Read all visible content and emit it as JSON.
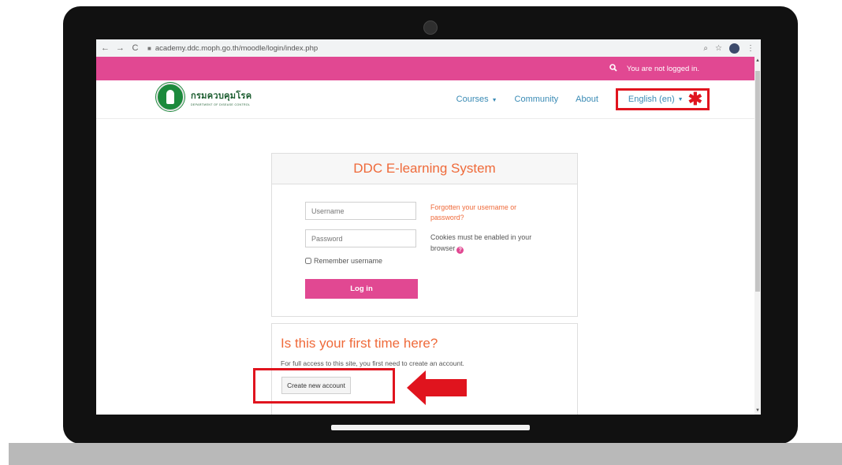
{
  "browser": {
    "url": "academy.ddc.moph.go.th/moodle/login/index.php",
    "back_icon": "←",
    "forward_icon": "→",
    "reload_icon": "C",
    "zoom_icon": "⌕",
    "star_icon": "☆",
    "menu_icon": "⋮"
  },
  "topbar": {
    "login_status": "You are not logged in.",
    "color": "#e14892"
  },
  "site": {
    "logo_thai": "กรมควบคุมโรค",
    "logo_english": "DEPARTMENT OF DISEASE CONTROL",
    "menu": {
      "courses": "Courses",
      "community": "Community",
      "about": "About",
      "language": "English (en)"
    },
    "annotation_asterisk": "✱"
  },
  "login": {
    "title": "DDC E-learning System",
    "username_placeholder": "Username",
    "password_placeholder": "Password",
    "remember_label": "Remember username",
    "login_button": "Log in",
    "forgot_link": "Forgotten your username or password?",
    "cookies_note": "Cookies must be enabled in your browser",
    "accent_color": "#ef6a3a"
  },
  "signup": {
    "title": "Is this your first time here?",
    "description": "For full access to this site, you first need to create an account.",
    "create_button": "Create new account"
  },
  "annotation": {
    "highlight_color": "#e0141e"
  }
}
